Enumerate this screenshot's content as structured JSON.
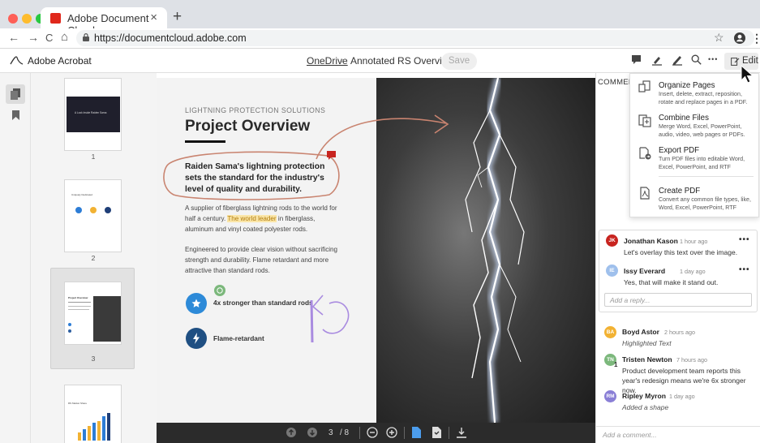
{
  "browser": {
    "tab_title": "Adobe Document Cloud",
    "tab_close": "×",
    "new_tab": "+",
    "url": "https://documentcloud.adobe.com",
    "nav": {
      "back": "←",
      "forward": "→",
      "reload": "C",
      "home": "⌂"
    },
    "star": "☆",
    "menu": "⋮"
  },
  "app": {
    "name": "Adobe Acrobat",
    "breadcrumb": [
      "OneDrive",
      "Annotated RS Overview"
    ],
    "breadcrumb_sep": "›",
    "save_label": "Save",
    "edit_label": "Edit",
    "more": "•••"
  },
  "thumbnails": {
    "pages": [
      {
        "number": "1",
        "text": "A Look Inside Raiden Sama"
      },
      {
        "number": "2",
        "text": "Uniquely Dedicated"
      },
      {
        "number": "3",
        "text": "Project Overview"
      },
      {
        "number": "4",
        "text": "RS Market Share"
      }
    ],
    "selected": "3"
  },
  "document": {
    "eyebrow": "LIGHTNING PROTECTION SOLUTIONS",
    "title": "Project Overview",
    "quote": "Raiden Sama's lightning protection sets the standard for the industry's level of quality and durability.",
    "para1_before": "A supplier of fiberglass lightning rods to the world for half a century. ",
    "para1_highlight": "The world leader",
    "para1_after": " in fiberglass, aluminum and vinyl coated polyester rods.",
    "para2": "Engineered to provide clear vision without sacrificing strength and durability. Flame retardant and more attractive than standard rods.",
    "bullet1": "4x stronger than standard rods",
    "bullet2": "Flame-retardant"
  },
  "pagebar": {
    "current": "3",
    "total": "/ 8"
  },
  "comments": {
    "label": "COMMEN",
    "thread": [
      {
        "initials": "JK",
        "name": "Jonathan Kason",
        "time": "1 hour ago",
        "text": "Let's overlay this text over the image.",
        "color": "#c8241f"
      },
      {
        "initials": "IE",
        "name": "Issy Everard",
        "time": "1 day ago",
        "text": "Yes, that will make it stand out.",
        "color": "#9fc0ec"
      }
    ],
    "reply_placeholder": "Add a reply...",
    "activity": [
      {
        "initials": "BA",
        "name": "Boyd Astor",
        "time": "2 hours ago",
        "text": "Highlighted Text",
        "color": "#f2b233",
        "italic": true
      },
      {
        "initials": "TN",
        "name": "Tristen Newton",
        "time": "7 hours ago",
        "text": "Product development team reports this year's redesign means we're 6x stronger now.",
        "color": "#7cb87c",
        "badge": "1"
      },
      {
        "initials": "RM",
        "name": "Ripley Myron",
        "time": "1 day ago",
        "text": "Added a shape",
        "color": "#8a7fd6",
        "italic": true
      }
    ],
    "add_placeholder": "Add a comment..."
  },
  "edit_menu": [
    {
      "title": "Organize Pages",
      "desc": "Insert, delete, extract, reposition, rotate and replace pages in a PDF.",
      "icon": "organize-pages-icon"
    },
    {
      "title": "Combine Files",
      "desc": "Merge Word, Excel, PowerPoint, audio, video, web pages or PDFs.",
      "icon": "combine-files-icon"
    },
    {
      "title": "Export PDF",
      "desc": "Turn PDF files into editable Word, Excel, PowerPoint, and RTF",
      "icon": "export-pdf-icon"
    },
    {
      "title": "Create PDF",
      "desc": "Convert any common file types, like, Word, Excel, PowerPoint, RTF",
      "icon": "create-pdf-icon"
    }
  ]
}
